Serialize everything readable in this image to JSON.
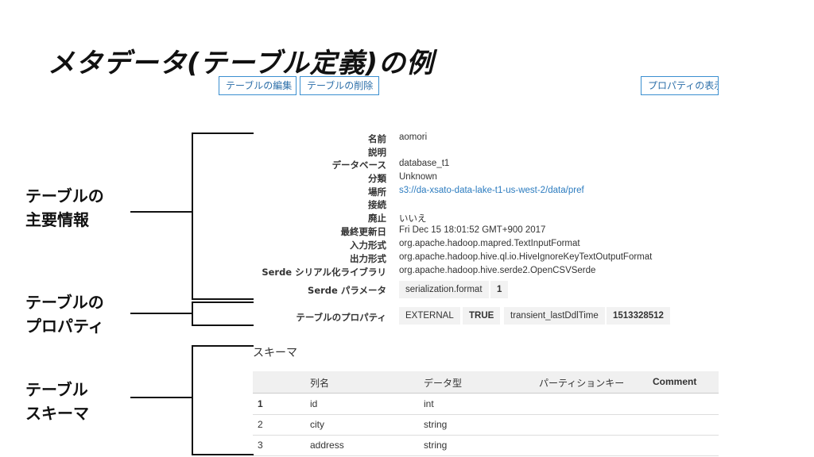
{
  "title": "メタデータ(テーブル定義)の例",
  "toolbar": {
    "edit_label": "テーブルの編集",
    "delete_label": "テーブルの削除",
    "props_label": "プロパティの表示"
  },
  "side_labels": {
    "main_info": [
      "テーブルの",
      "主要情報"
    ],
    "properties": [
      "テーブルの",
      "プロパティ"
    ],
    "schema": [
      "テーブル",
      "スキーマ"
    ]
  },
  "details": [
    {
      "label": "名前",
      "value": "aomori"
    },
    {
      "label": "説明",
      "value": ""
    },
    {
      "label": "データベース",
      "value": "database_t1"
    },
    {
      "label": "分類",
      "value": "Unknown"
    },
    {
      "label": "場所",
      "value": "s3://da-xsato-data-lake-t1-us-west-2/data/pref"
    },
    {
      "label": "接続",
      "value": ""
    },
    {
      "label": "廃止",
      "value": "いいえ"
    },
    {
      "label": "最終更新日",
      "value": "Fri Dec 15 18:01:52 GMT+900 2017"
    },
    {
      "label": "入力形式",
      "value": "org.apache.hadoop.mapred.TextInputFormat"
    },
    {
      "label": "出力形式",
      "value": "org.apache.hadoop.hive.ql.io.HiveIgnoreKeyTextOutputFormat"
    },
    {
      "label": "Serde シリアル化ライブラリ",
      "value": "org.apache.hadoop.hive.serde2.OpenCSVSerde"
    }
  ],
  "serde_params": {
    "label": "Serde パラメータ",
    "key": "serialization.format",
    "value": "1"
  },
  "table_props": {
    "label": "テーブルのプロパティ",
    "chips": [
      "EXTERNAL",
      "TRUE",
      "transient_lastDdlTime",
      "1513328512"
    ]
  },
  "schema": {
    "title": "スキーマ",
    "headers": [
      "列名",
      "データ型",
      "パーティションキー",
      "Comment"
    ],
    "rows": [
      {
        "num": "1",
        "name": "id",
        "type": "int"
      },
      {
        "num": "2",
        "name": "city",
        "type": "string"
      },
      {
        "num": "3",
        "name": "address",
        "type": "string"
      }
    ]
  }
}
